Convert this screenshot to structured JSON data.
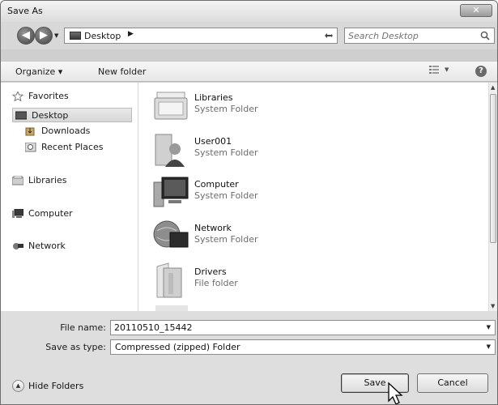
{
  "window": {
    "title": "Save As",
    "close_glyph": "✕"
  },
  "nav": {
    "back_glyph": "◀",
    "forward_glyph": "▶",
    "address": {
      "location": "Desktop",
      "separator": "▶"
    },
    "search": {
      "placeholder": "Search Desktop"
    }
  },
  "toolbar": {
    "organize": "Organize ▾",
    "new_folder": "New folder",
    "help": "?"
  },
  "sidebar": {
    "items": [
      {
        "label": "Favorites",
        "icon": "star-icon"
      },
      {
        "label": "Desktop",
        "icon": "desktop-icon",
        "selected": true
      },
      {
        "label": "Downloads",
        "icon": "downloads-icon"
      },
      {
        "label": "Recent Places",
        "icon": "recent-places-icon"
      },
      {
        "label": "Libraries",
        "icon": "libraries-icon"
      },
      {
        "label": "Computer",
        "icon": "computer-icon"
      },
      {
        "label": "Network",
        "icon": "network-icon"
      }
    ]
  },
  "files": [
    {
      "name": "Libraries",
      "type": "System Folder",
      "icon": "libraries-folder-icon"
    },
    {
      "name": "User001",
      "type": "System Folder",
      "icon": "user-folder-icon"
    },
    {
      "name": "Computer",
      "type": "System Folder",
      "icon": "computer-folder-icon"
    },
    {
      "name": "Network",
      "type": "System Folder",
      "icon": "network-folder-icon"
    },
    {
      "name": "Drivers",
      "type": "File folder",
      "icon": "folder-icon"
    }
  ],
  "form": {
    "file_name_label": "File name:",
    "file_name_value": "20110510_15442",
    "save_type_label": "Save as type:",
    "save_type_value": "Compressed (zipped) Folder"
  },
  "footer": {
    "hide_folders": "Hide Folders",
    "save": "Save",
    "cancel": "Cancel"
  }
}
